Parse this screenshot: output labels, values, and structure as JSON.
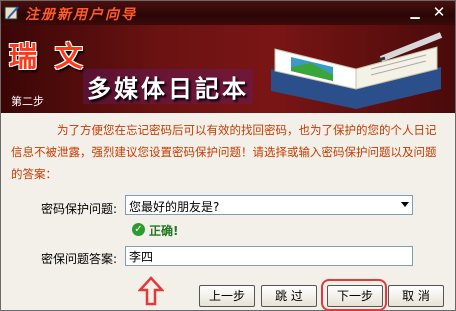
{
  "window": {
    "title": "注册新用户向导",
    "colors": {
      "title_text": "#ff5a28",
      "banner": "#6b1212",
      "accent": "#e23a3a"
    }
  },
  "titlebar": {
    "minimize_icon": "minimize-icon",
    "close_icon": "close-icon"
  },
  "banner": {
    "brand": "瑞 文",
    "app_name": "多媒体日記本",
    "step": "第二步"
  },
  "main": {
    "description": "为了方便您在忘记密码后可以有效的找回密码，也为了保护的您的个人日记信息不被泄露，强烈建议您设置密码保护问题！请选择或输入密码保护问题以及问题的答案：",
    "question_label": "密码保护问题:",
    "question_value": "您最好的朋友是?",
    "validation_text": "正确!",
    "answer_label": "密保问题答案:",
    "answer_value": "李四"
  },
  "buttons": {
    "prev": "上一步",
    "skip": "跳 过",
    "next": "下一步",
    "cancel": "取 消"
  }
}
